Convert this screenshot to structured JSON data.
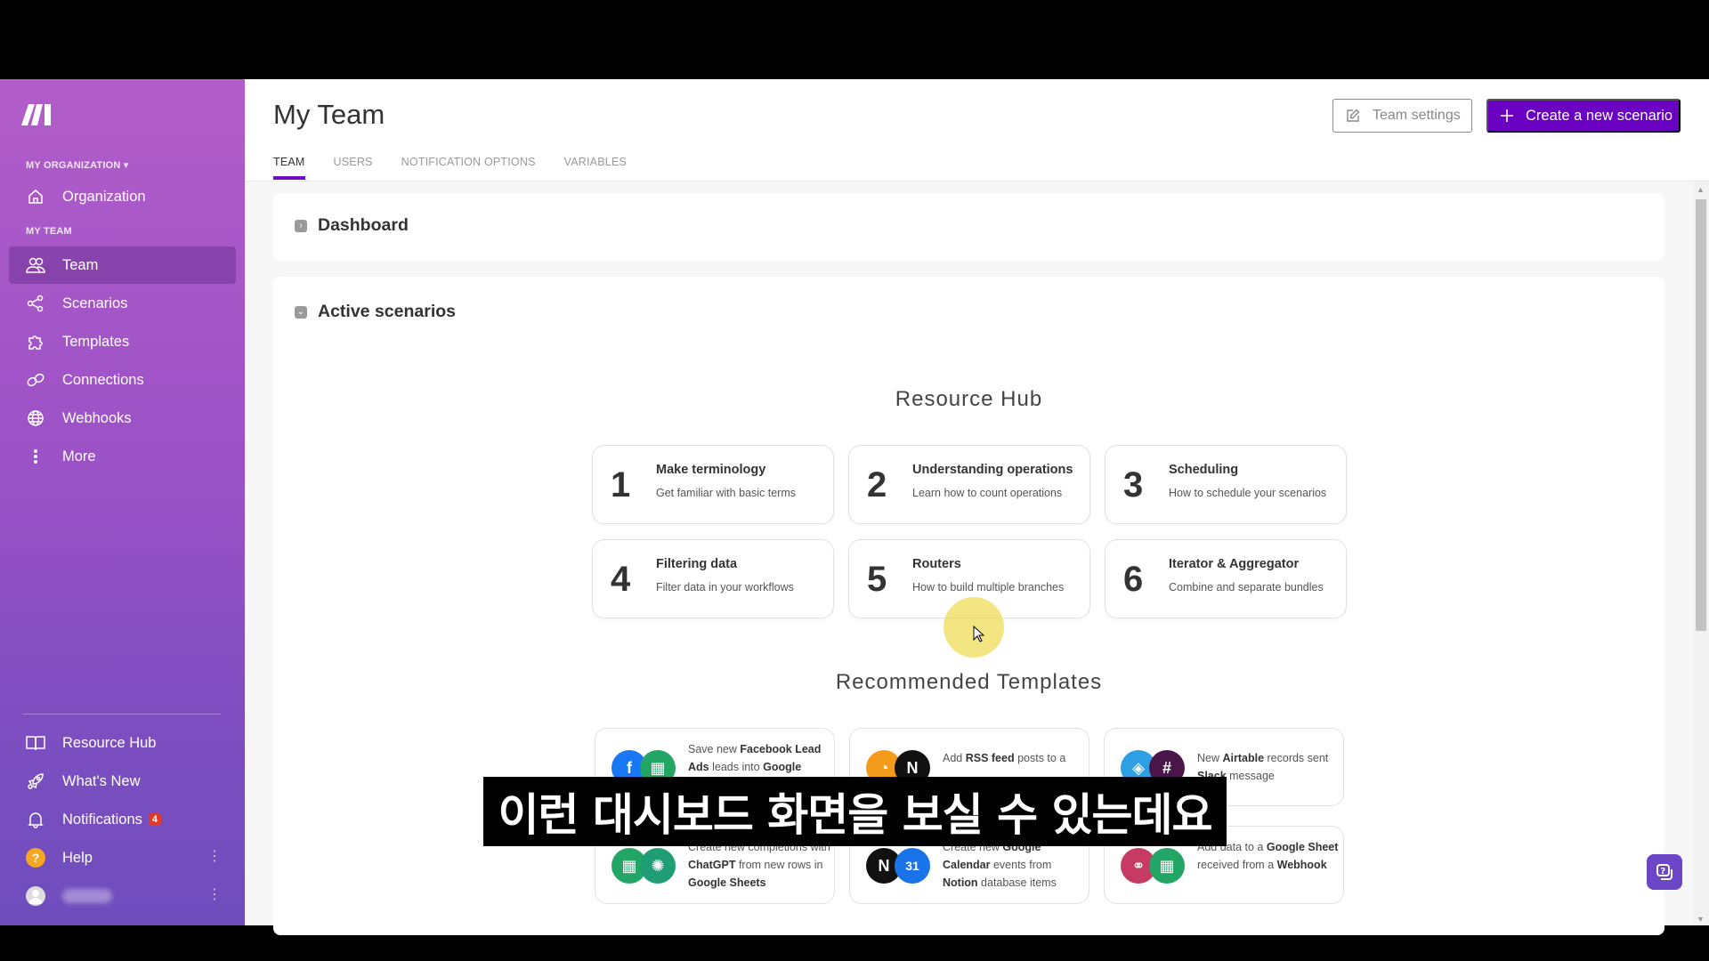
{
  "sidebar": {
    "org_section": "MY ORGANIZATION",
    "team_section": "MY TEAM",
    "items": [
      {
        "label": "Organization",
        "icon": "home-icon"
      },
      {
        "label": "Team",
        "icon": "users-icon",
        "active": true
      },
      {
        "label": "Scenarios",
        "icon": "share-nodes-icon"
      },
      {
        "label": "Templates",
        "icon": "puzzle-icon"
      },
      {
        "label": "Connections",
        "icon": "link-icon"
      },
      {
        "label": "Webhooks",
        "icon": "globe-icon"
      },
      {
        "label": "More",
        "icon": "more-vertical-icon"
      }
    ],
    "bottom": [
      {
        "label": "Resource Hub",
        "icon": "book-icon"
      },
      {
        "label": "What's New",
        "icon": "rocket-icon"
      },
      {
        "label": "Notifications",
        "icon": "bell-icon",
        "badge": "4"
      },
      {
        "label": "Help",
        "icon": "help-icon"
      }
    ]
  },
  "header": {
    "title": "My Team",
    "tabs": [
      "TEAM",
      "USERS",
      "NOTIFICATION OPTIONS",
      "VARIABLES"
    ],
    "active_tab": "TEAM",
    "team_settings_label": "Team settings",
    "create_label": "Create a new scenario",
    "accent": "#6a00c2"
  },
  "panels": {
    "dashboard": "Dashboard",
    "active_scenarios": "Active scenarios"
  },
  "resource_hub": {
    "title": "Resource Hub",
    "cards": [
      {
        "num": "1",
        "name": "Make terminology",
        "desc": "Get familiar with basic terms"
      },
      {
        "num": "2",
        "name": "Understanding operations",
        "desc": "Learn how to count operations"
      },
      {
        "num": "3",
        "name": "Scheduling",
        "desc": "How to schedule your scenarios"
      },
      {
        "num": "4",
        "name": "Filtering data",
        "desc": "Filter data in your workflows"
      },
      {
        "num": "5",
        "name": "Routers",
        "desc": "How to build multiple branches"
      },
      {
        "num": "6",
        "name": "Iterator & Aggregator",
        "desc": "Combine and separate bundles"
      }
    ]
  },
  "recommended": {
    "title": "Recommended Templates",
    "cards": [
      {
        "parts": [
          "Save new ",
          "Facebook Lead Ads",
          " leads into ",
          "Google",
          ""
        ],
        "apps": [
          "facebook",
          "google-sheets"
        ]
      },
      {
        "parts": [
          "Add ",
          "RSS feed",
          " posts to a",
          "",
          ""
        ],
        "apps": [
          "rss",
          "notion"
        ]
      },
      {
        "parts": [
          "New ",
          "Airtable",
          " records sent ",
          "Slack",
          " message"
        ],
        "apps": [
          "airtable",
          "slack"
        ]
      },
      {
        "parts": [
          "Create new completions with ",
          "ChatGPT",
          " from new rows in ",
          "Google Sheets",
          ""
        ],
        "apps": [
          "google-sheets",
          "chatgpt"
        ]
      },
      {
        "parts": [
          "Create new ",
          "Google Calendar",
          " events from ",
          "Notion",
          " database items"
        ],
        "apps": [
          "notion",
          "google-calendar"
        ]
      },
      {
        "parts": [
          "Add data to a ",
          "Google Sheet",
          " received from a ",
          "Webhook",
          ""
        ],
        "apps": [
          "webhook",
          "google-sheets"
        ]
      }
    ]
  },
  "subtitle": "이런 대시보드 화면을 보실 수 있는데요"
}
